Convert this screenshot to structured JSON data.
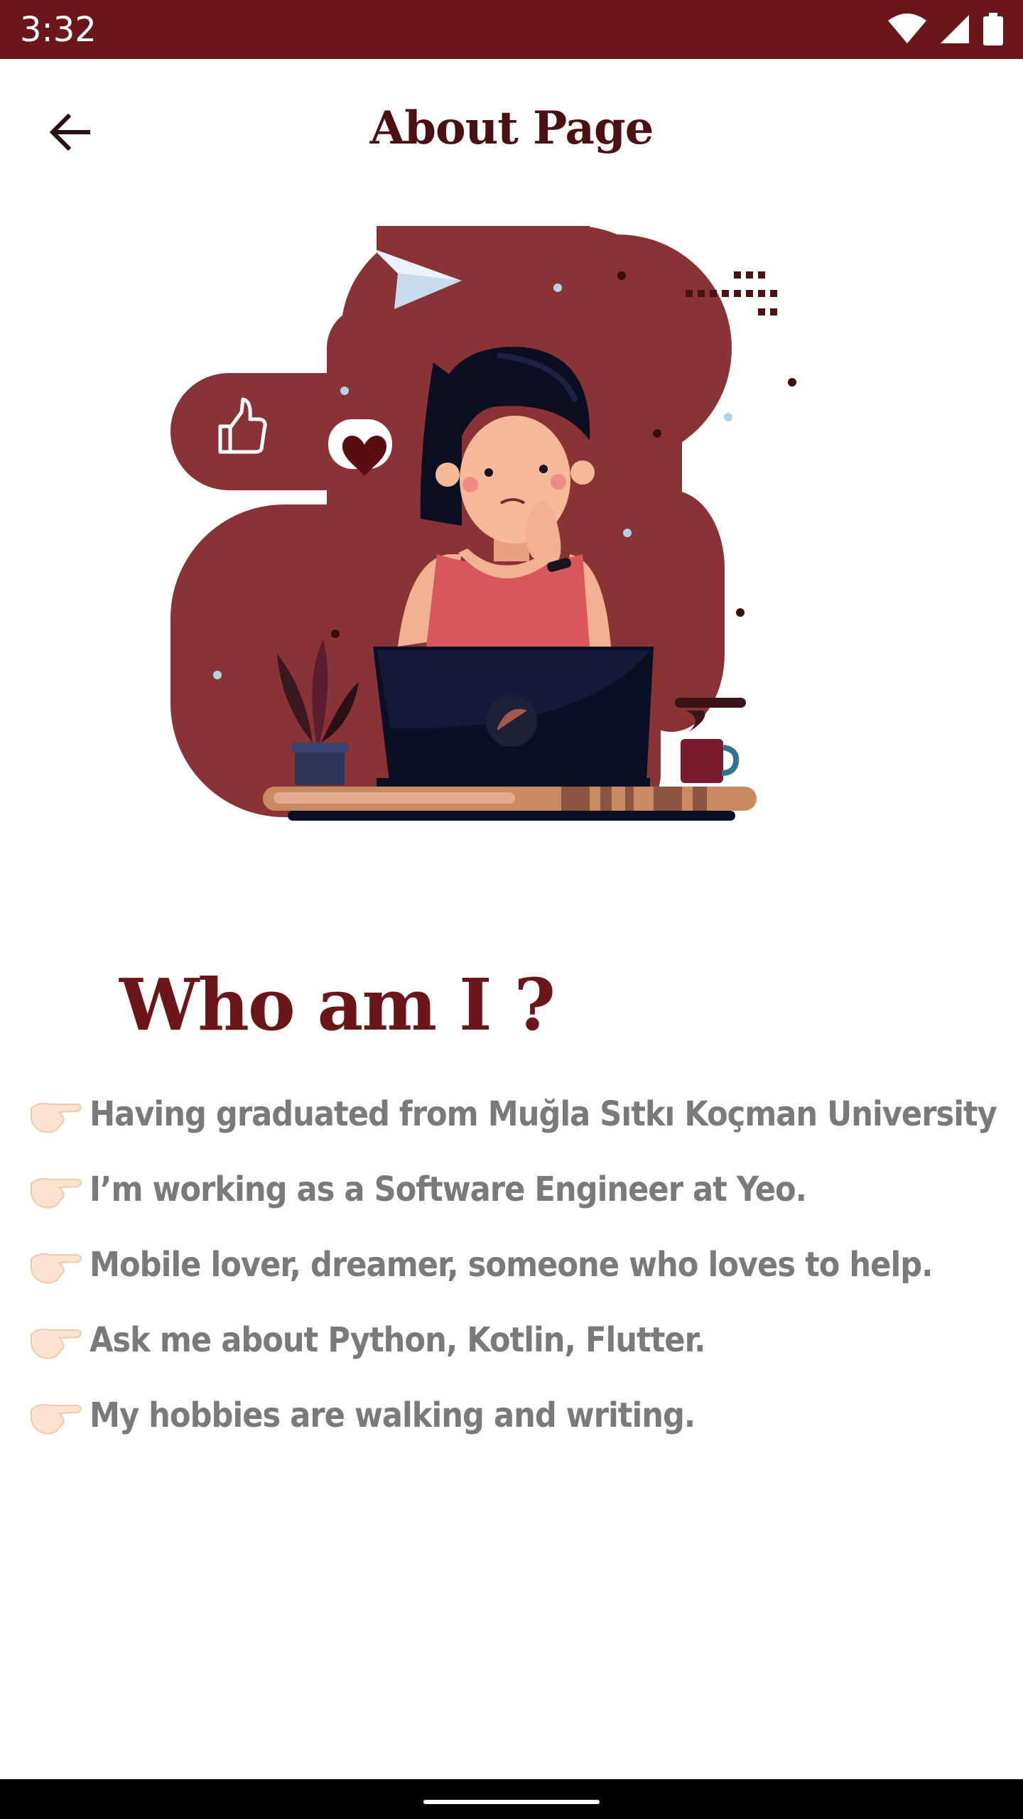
{
  "status_bar": {
    "time": "3:32"
  },
  "app_bar": {
    "title": "About Page",
    "back_icon": "arrow-back-icon"
  },
  "colors": {
    "primary": "#6b1619",
    "blob": "#8a3336",
    "text_gray": "#7a7a7a"
  },
  "about": {
    "heading": "Who am I ?",
    "bullet_icon": "pointing-hand-icon",
    "facts": [
      "Having graduated from Muğla Sıtkı Koçman University",
      "I’m working as a Software Engineer at Yeo.",
      "Mobile lover, dreamer, someone who loves to help.",
      "Ask me about Python, Kotlin, Flutter.",
      "My hobbies are walking and writing."
    ]
  }
}
